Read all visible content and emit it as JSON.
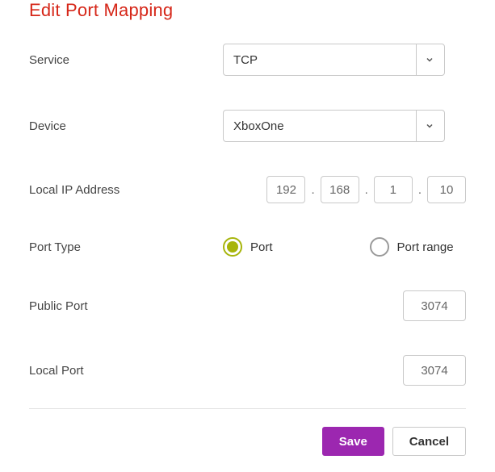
{
  "title": "Edit Port Mapping",
  "labels": {
    "service": "Service",
    "device": "Device",
    "local_ip": "Local IP Address",
    "port_type": "Port Type",
    "public_port": "Public Port",
    "local_port": "Local Port"
  },
  "service": {
    "selected": "TCP"
  },
  "device": {
    "selected": "XboxOne"
  },
  "local_ip": {
    "octets": [
      "192",
      "168",
      "1",
      "10"
    ]
  },
  "port_type": {
    "options": {
      "port": "Port",
      "port_range": "Port range"
    },
    "selected": "port"
  },
  "public_port": "3074",
  "local_port": "3074",
  "buttons": {
    "save": "Save",
    "cancel": "Cancel"
  },
  "colors": {
    "accent": "#9c27b0",
    "radio": "#a7b50b",
    "title": "#d62719"
  }
}
